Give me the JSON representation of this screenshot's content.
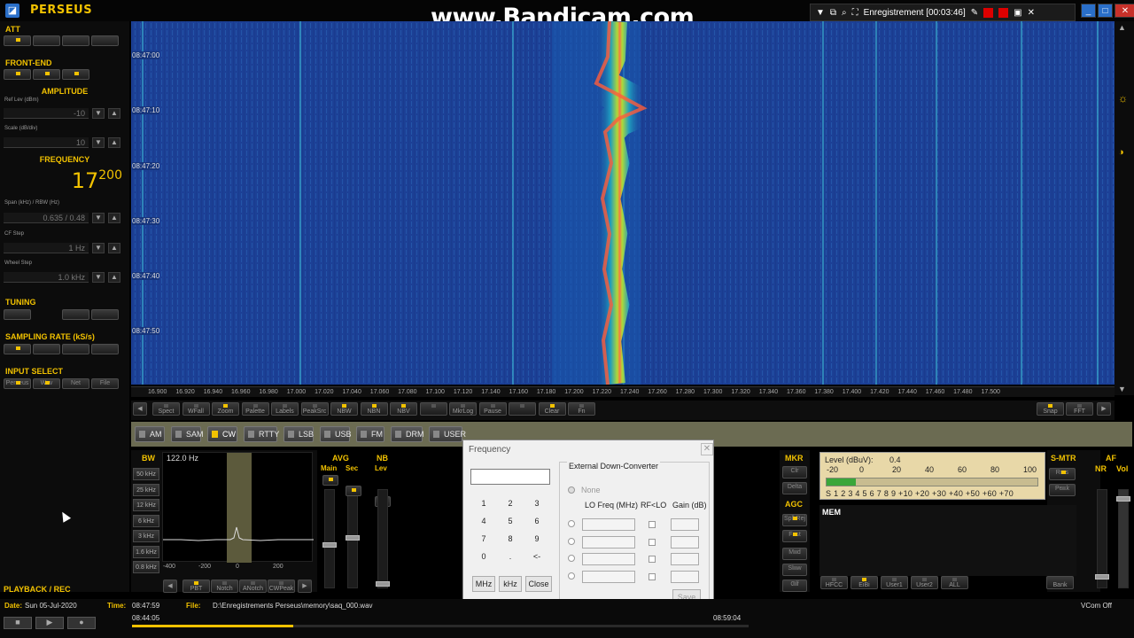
{
  "app": {
    "title": "PERSEUS"
  },
  "watermark": "www.Bandicam.com",
  "recorder": {
    "status": "Enregistrement [00:03:46]"
  },
  "left": {
    "att_title": "ATT",
    "frontend_title": "FRONT-END",
    "amplitude_title": "AMPLITUDE",
    "ref_label": "Ref Lev (dBm)",
    "ref_value": "-10",
    "scale_label": "Scale (dB/div)",
    "scale_value": "10",
    "frequency_title": "FREQUENCY",
    "freq_big": "17",
    "freq_small": "200",
    "span_label": "Span (kHz) / RBW (Hz)",
    "span_value": "0.635 / 0.48",
    "cfstep_label": "CF Step",
    "cfstep_value": "1 Hz",
    "wheel_label": "Wheel Step",
    "wheel_value": "1.0 kHz",
    "tuning_title": "TUNING",
    "sampling_title": "SAMPLING RATE (kS/s)",
    "input_title": "INPUT SELECT",
    "input_buttons": [
      "Perseus",
      "Wav",
      "Net",
      "File"
    ],
    "playback_title": "PLAYBACK / REC"
  },
  "waterfall": {
    "times": [
      "08:47:00",
      "08:47:10",
      "08:47:20",
      "08:47:30",
      "08:47:40",
      "08:47:50"
    ],
    "freq_ticks": [
      "16.900",
      "16.920",
      "16.940",
      "16.960",
      "16.980",
      "17.000",
      "17.020",
      "17.040",
      "17.060",
      "17.080",
      "17.100",
      "17.120",
      "17.140",
      "17.160",
      "17.180",
      "17.200",
      "17.220",
      "17.240",
      "17.260",
      "17.280",
      "17.300",
      "17.320",
      "17.340",
      "17.360",
      "17.380",
      "17.400",
      "17.420",
      "17.440",
      "17.460",
      "17.480",
      "17.500"
    ]
  },
  "toolbar": {
    "buttons": [
      "Spect",
      "WFall",
      "Zoom",
      "Palette",
      "Labels",
      "PeakSrc",
      "NBW",
      "NBN",
      "NBV",
      "",
      "MkrLog",
      "Pause",
      "",
      "Clear",
      "Fn"
    ],
    "right_buttons": [
      "Snap",
      "FFT"
    ]
  },
  "modes": [
    {
      "label": "AM",
      "on": false
    },
    {
      "label": "SAM",
      "on": false
    },
    {
      "label": "CW",
      "on": true
    },
    {
      "label": "RTTY",
      "on": false
    },
    {
      "label": "LSB",
      "on": false
    },
    {
      "label": "USB",
      "on": false
    },
    {
      "label": "FM",
      "on": false
    },
    {
      "label": "DRM",
      "on": false
    },
    {
      "label": "USER",
      "on": false
    }
  ],
  "bw": {
    "title": "BW",
    "value": "122.0 Hz",
    "buttons": [
      "50 kHz",
      "25 kHz",
      "12 kHz",
      "6 kHz",
      "3 kHz",
      "1.6 kHz",
      "0.8 kHz"
    ],
    "x_ticks": [
      "-400",
      "-200",
      "0",
      "200"
    ],
    "bottom_buttons": [
      "PBT",
      "Notch",
      "ANotch",
      "CWPeak"
    ]
  },
  "avg": {
    "title": "AVG",
    "main": "Main",
    "sec": "Sec"
  },
  "nb": {
    "title": "NB",
    "lev": "Lev"
  },
  "dialog": {
    "title": "Frequency",
    "keys": [
      "1",
      "2",
      "3",
      "4",
      "5",
      "6",
      "7",
      "8",
      "9",
      "0",
      ".",
      "<-"
    ],
    "mhz": "MHz",
    "khz": "kHz",
    "close": "Close",
    "edc_title": "External Down-Converter",
    "none": "None",
    "col_lo": "LO Freq (MHz)",
    "col_rf": "RF<LO",
    "col_gain": "Gain (dB)",
    "save": "Save"
  },
  "mkr": {
    "title": "MKR",
    "buttons": [
      "Clr",
      "Delta"
    ],
    "agc": "AGC",
    "agc_buttons": [
      "SplkRej",
      "Fast",
      "Med",
      "Slow",
      "Off"
    ]
  },
  "meter": {
    "level_label": "Level (dBuV):",
    "level_value": "0.4",
    "top_scale": [
      "-20",
      "0",
      "20",
      "40",
      "60",
      "80",
      "100"
    ],
    "bottom_scale": "S  1  2  3  4  5  6  7  8  9  +10 +20 +30 +40 +50 +60 +70",
    "level_fraction": 0.14
  },
  "mem": {
    "title": "MEM",
    "buttons": [
      "HFCC",
      "EiBi",
      "User1",
      "User2",
      "ALL"
    ],
    "bank": "Bank"
  },
  "smtr": {
    "title": "S-MTR",
    "buttons": [
      "Rms",
      "Peak"
    ],
    "nr": "NR",
    "af": "AF",
    "vol": "Vol"
  },
  "status": {
    "date_label": "Date:",
    "date_value": "Sun 05-Jul-2020",
    "time_label": "Time:",
    "time_value": "08:47:59",
    "file_label": "File:",
    "file_value": "D:\\Enregistrements Perseus\\memory\\saq_000.wav",
    "start_time": "08:44:05",
    "end_time": "08:59:04",
    "vcom": "VCom Off",
    "progress_fraction": 0.262
  },
  "colors": {
    "accent": "#f2c200",
    "waterfall_bg": "#1c4096"
  }
}
